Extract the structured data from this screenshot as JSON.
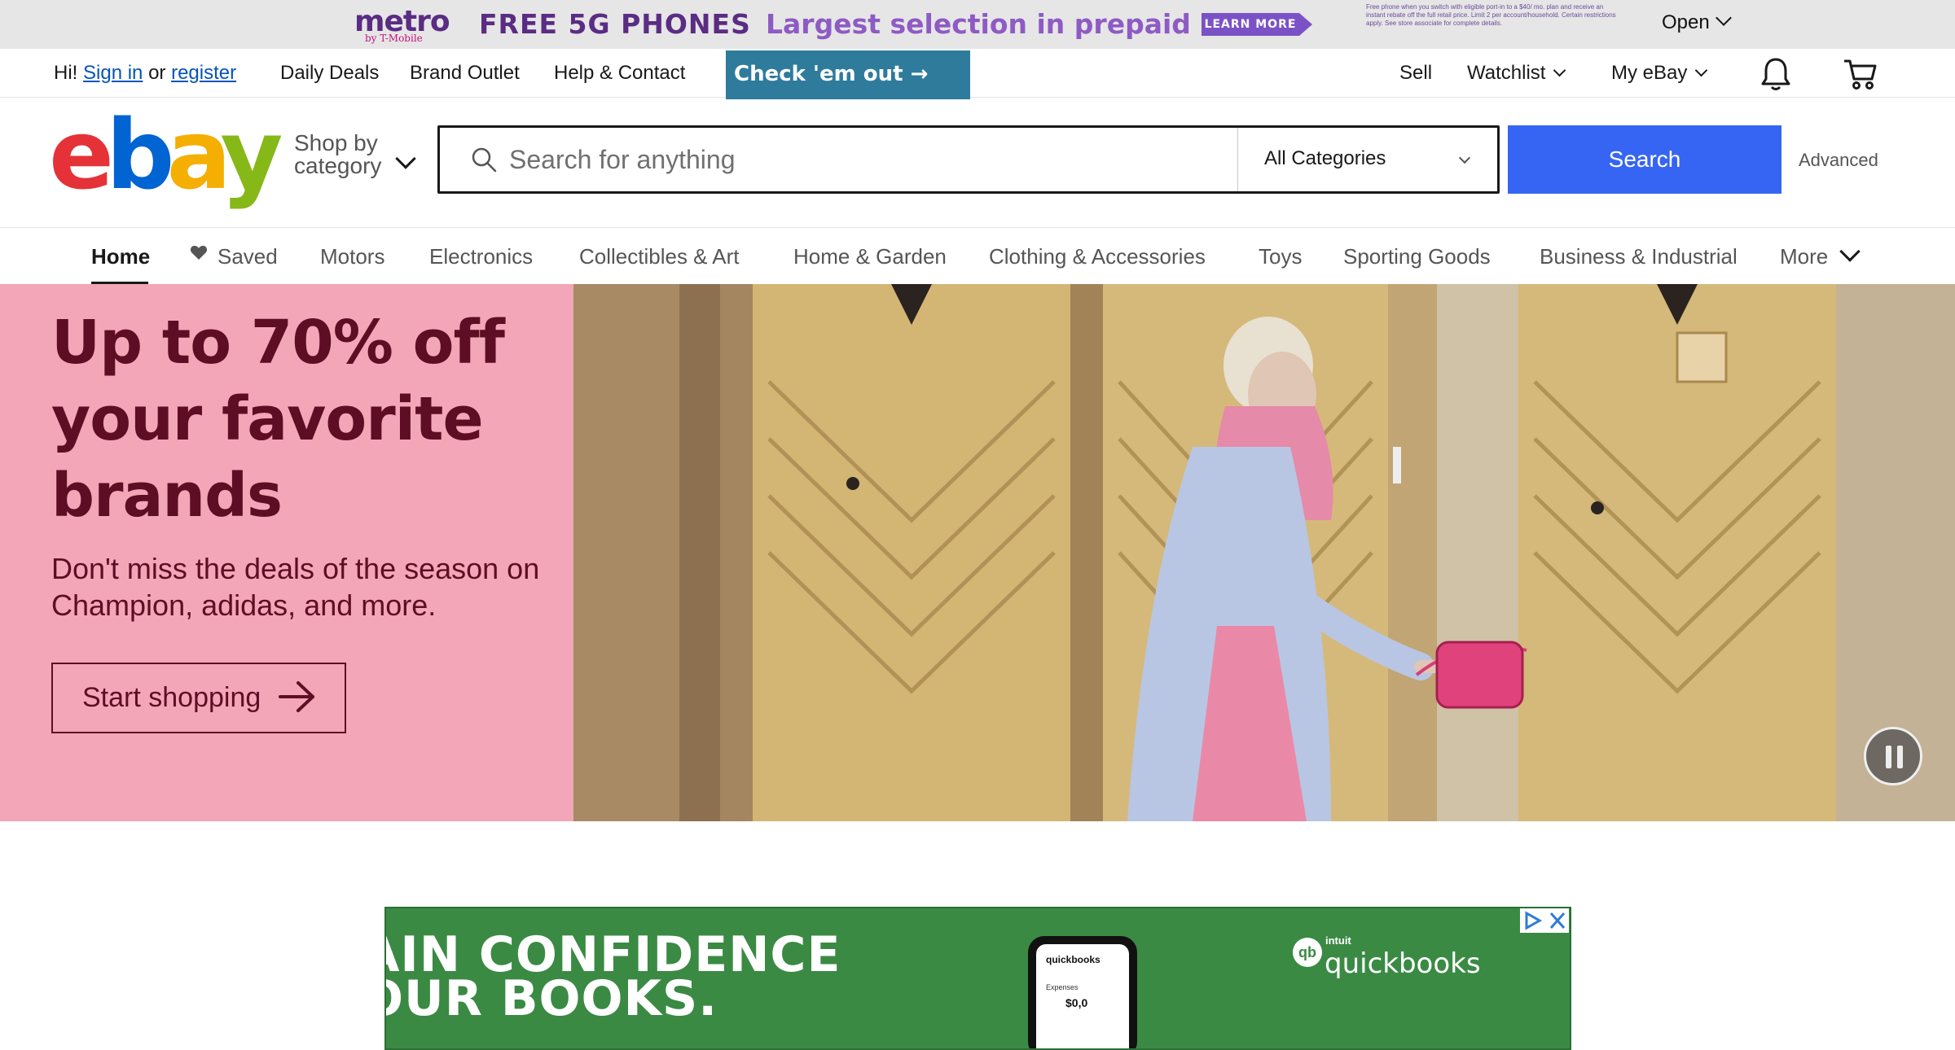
{
  "promo": {
    "logo": "metro",
    "logo_sub": "by T-Mobile",
    "headline": "FREE 5G PHONES",
    "subheadline": "Largest selection in prepaid",
    "cta": "LEARN MORE",
    "fine_print": "Free phone when you switch with eligible port-in to a $40/ mo. plan and receive an instant rebate off the full retail price. Limit 2 per account/household. Certain restrictions apply. See store associate for complete details.",
    "open_label": "Open"
  },
  "topnav": {
    "greeting": "Hi!",
    "sign_in": "Sign in",
    "or": "or",
    "register": "register",
    "daily_deals": "Daily Deals",
    "brand_outlet": "Brand Outlet",
    "help": "Help & Contact",
    "check_em_out": "Check 'em out →",
    "sell": "Sell",
    "watchlist": "Watchlist",
    "my_ebay": "My eBay",
    "icons": [
      "bell-icon",
      "cart-icon"
    ]
  },
  "header": {
    "logo_letters": [
      "e",
      "b",
      "a",
      "y"
    ],
    "logo_colors": [
      "#e53238",
      "#0064d2",
      "#f5af02",
      "#86b817"
    ],
    "shop_by_line1": "Shop by",
    "shop_by_line2": "category",
    "search_placeholder": "Search for anything",
    "category_selected": "All Categories",
    "search_button": "Search",
    "advanced": "Advanced"
  },
  "catnav": {
    "items": [
      {
        "label": "Home",
        "active": true
      },
      {
        "label": "Saved"
      },
      {
        "label": "Motors"
      },
      {
        "label": "Electronics"
      },
      {
        "label": "Collectibles & Art"
      },
      {
        "label": "Home & Garden"
      },
      {
        "label": "Clothing & Accessories"
      },
      {
        "label": "Toys"
      },
      {
        "label": "Sporting Goods"
      },
      {
        "label": "Business & Industrial"
      },
      {
        "label": "More"
      }
    ]
  },
  "hero": {
    "title": "Up to 70% off your favorite brands",
    "subtitle": "Don't miss the deals of the season on Champion, adidas, and more.",
    "cta": "Start shopping",
    "bg_color": "#f2a6b8",
    "text_color": "#5e0e24"
  },
  "ad": {
    "headline_line1": "AIN CONFIDENCE",
    "headline_line2": "OUR BOOKS.",
    "phone_brand": "quickbooks",
    "phone_label": "Expenses",
    "phone_value": "$0,0",
    "brand_prefix": "intuit",
    "brand_name": "quickbooks",
    "brand_icon": "qb",
    "bg_color": "#3a8a44"
  }
}
